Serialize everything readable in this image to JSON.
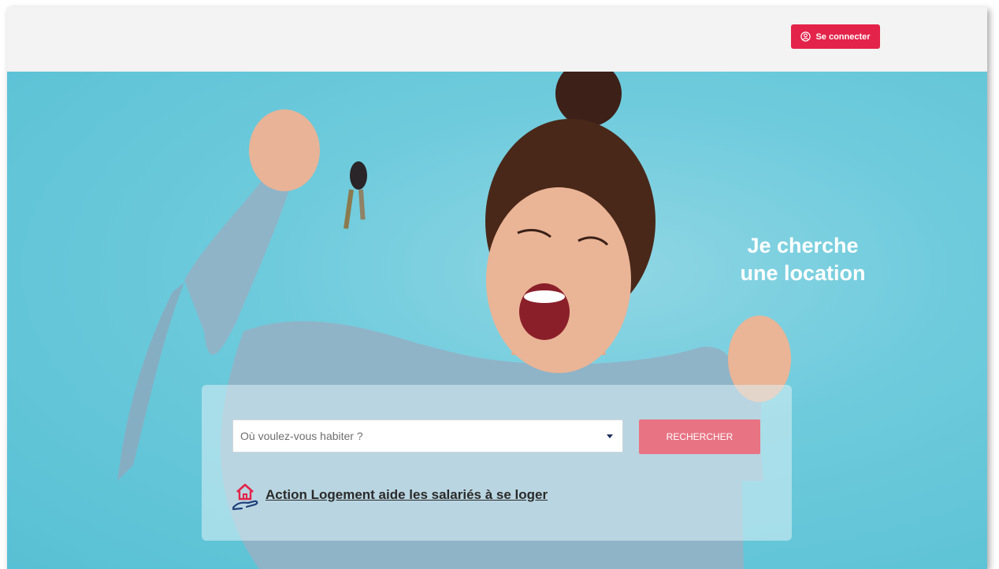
{
  "header": {
    "login_label": "Se connecter",
    "login_icon": "user-circle-icon"
  },
  "hero": {
    "headline_line1": "Je cherche",
    "headline_line2": "une location",
    "image": "woman-holding-keys-photo"
  },
  "search": {
    "placeholder": "Où voulez-vous habiter ?",
    "button_label": "RECHERCHER"
  },
  "promo": {
    "link_text": "Action Logement aide les salariés à se loger",
    "icon": "house-in-hand-icon"
  },
  "colors": {
    "brand_red": "#e4234a",
    "search_button": "#e87383",
    "hero_bg": "#6ecbdc",
    "topbar_bg": "#f3f3f3"
  }
}
